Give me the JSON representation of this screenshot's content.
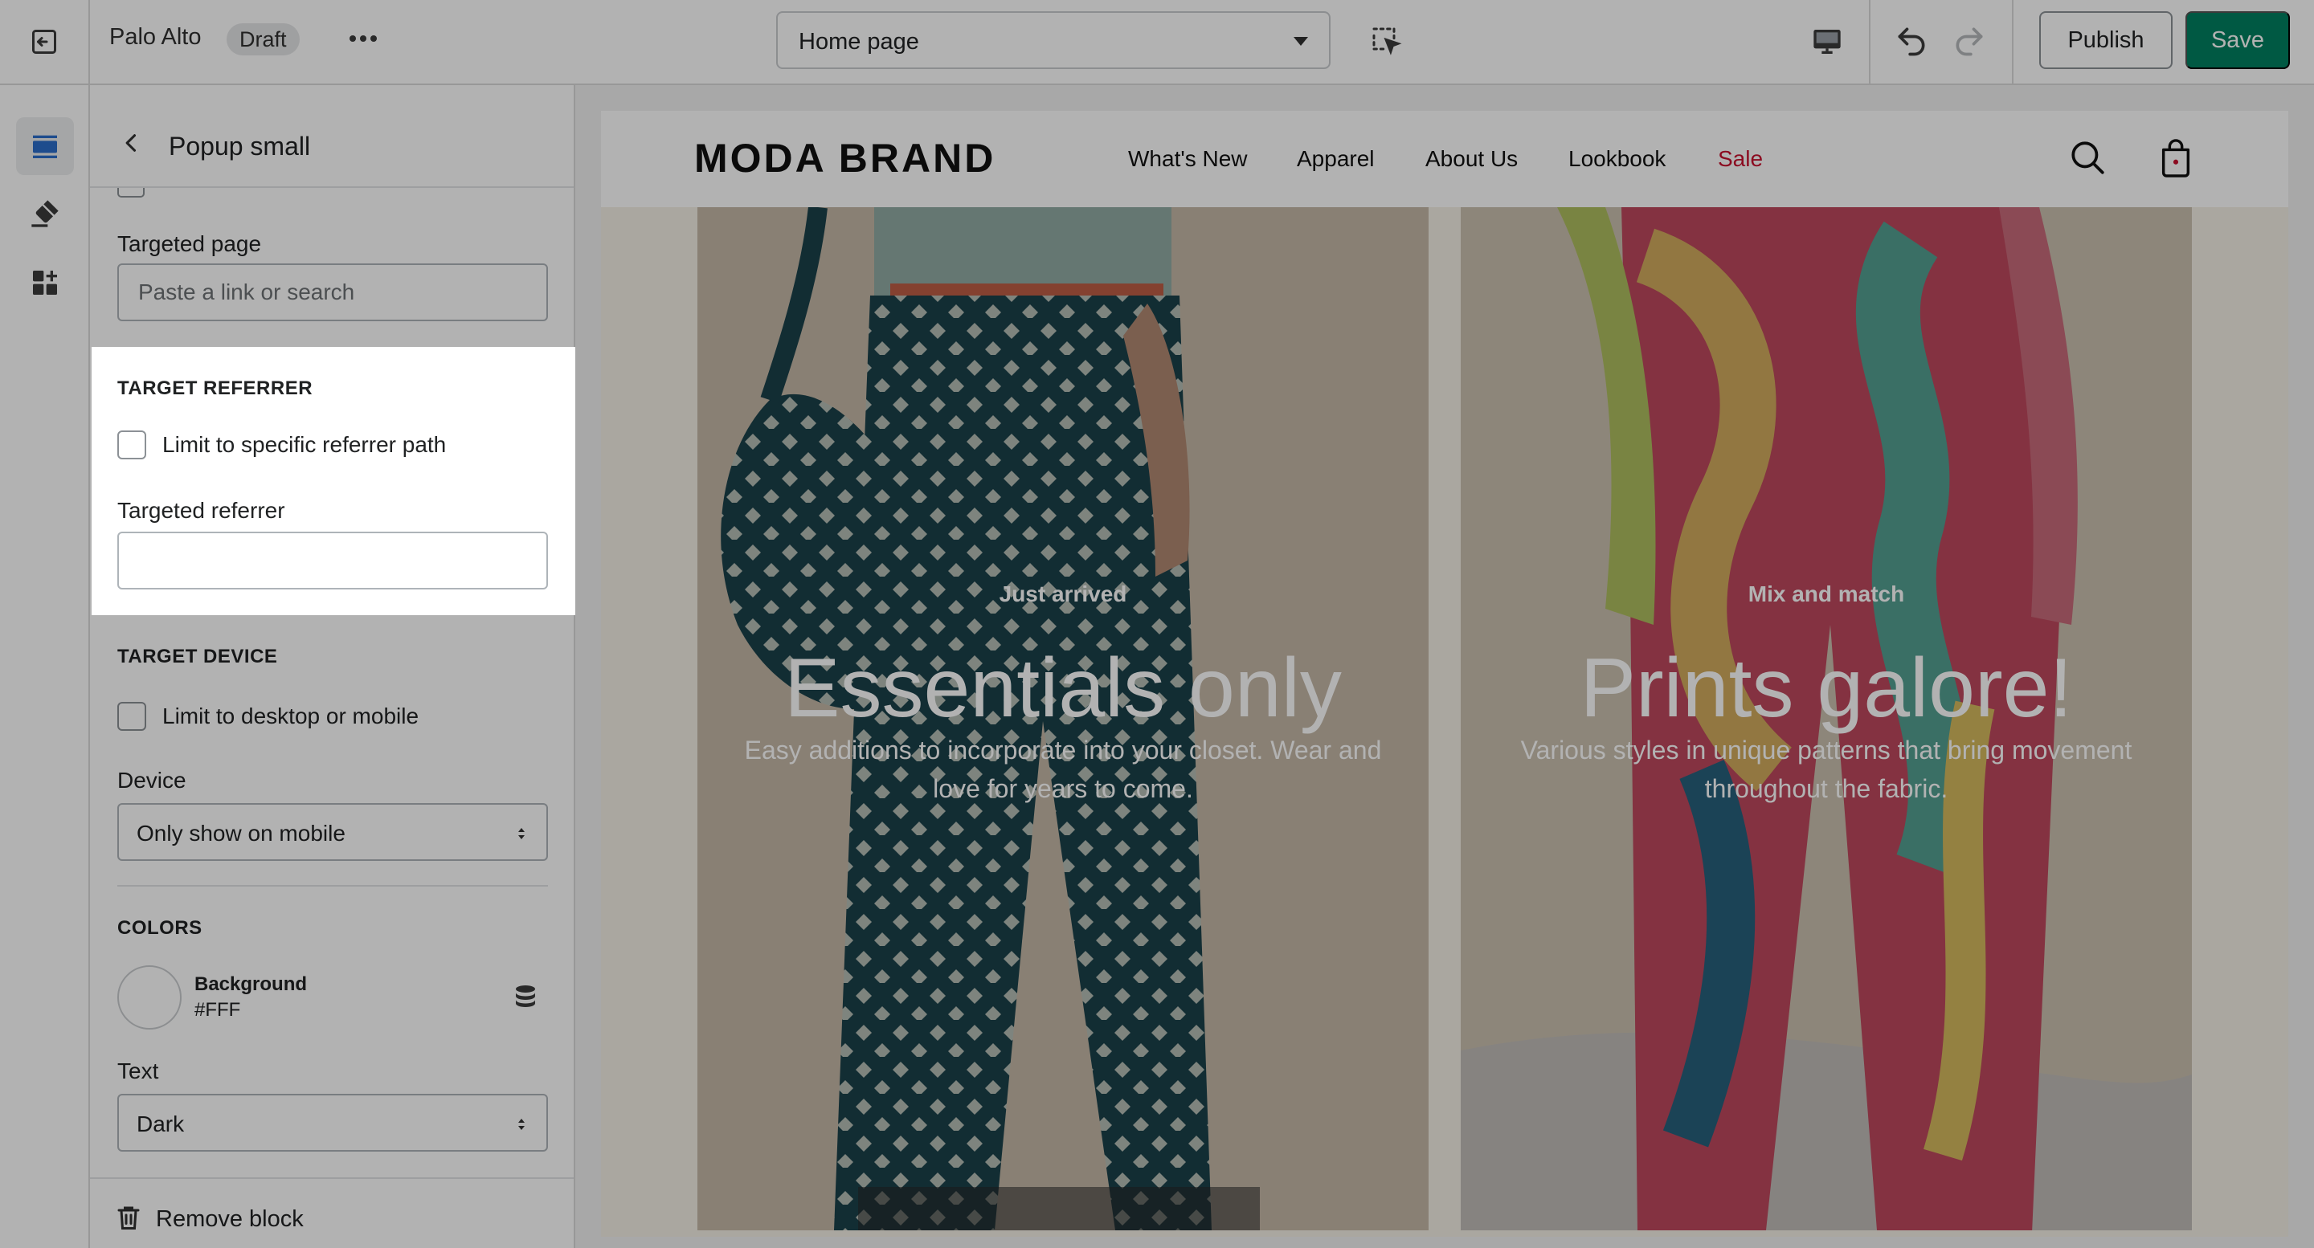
{
  "topbar": {
    "store_name": "Palo Alto",
    "status_badge": "Draft",
    "page_selector": "Home page",
    "publish_label": "Publish",
    "save_label": "Save",
    "icons": [
      "exit-icon",
      "more-icon",
      "inspect-icon",
      "desktop-icon",
      "undo-icon",
      "redo-icon"
    ]
  },
  "rail": {
    "items": [
      "sections-icon",
      "theme-settings-icon",
      "app-embeds-icon"
    ]
  },
  "panel": {
    "title": "Popup small",
    "targeted_page": {
      "label": "Targeted page",
      "placeholder": "Paste a link or search",
      "value": ""
    },
    "target_referrer": {
      "heading": "TARGET REFERRER",
      "checkbox_label": "Limit to specific referrer path",
      "checked": false,
      "field_label": "Targeted referrer",
      "value": ""
    },
    "target_device": {
      "heading": "TARGET DEVICE",
      "checkbox_label": "Limit to desktop or mobile",
      "checked": false,
      "device_label": "Device",
      "device_value": "Only show on mobile"
    },
    "colors": {
      "heading": "COLORS",
      "background_label": "Background",
      "background_value": "#FFF",
      "text_label": "Text",
      "text_value": "Dark"
    },
    "remove_label": "Remove block"
  },
  "preview": {
    "brand": "MODA BRAND",
    "nav": [
      "What's New",
      "Apparel",
      "About Us",
      "Lookbook",
      "Sale"
    ],
    "sale_color": "#c8102e",
    "heroes": [
      {
        "kicker": "Just arrived",
        "title": "Essentials only",
        "description": "Easy additions to incorporate into your closet. Wear and love for years to come."
      },
      {
        "kicker": "Mix and match",
        "title": "Prints galore!",
        "description": "Various styles in unique patterns that bring movement throughout the fabric."
      }
    ]
  },
  "colors": {
    "accent_green": "#008060",
    "overlay": "rgba(0,0,0,0.30)"
  }
}
